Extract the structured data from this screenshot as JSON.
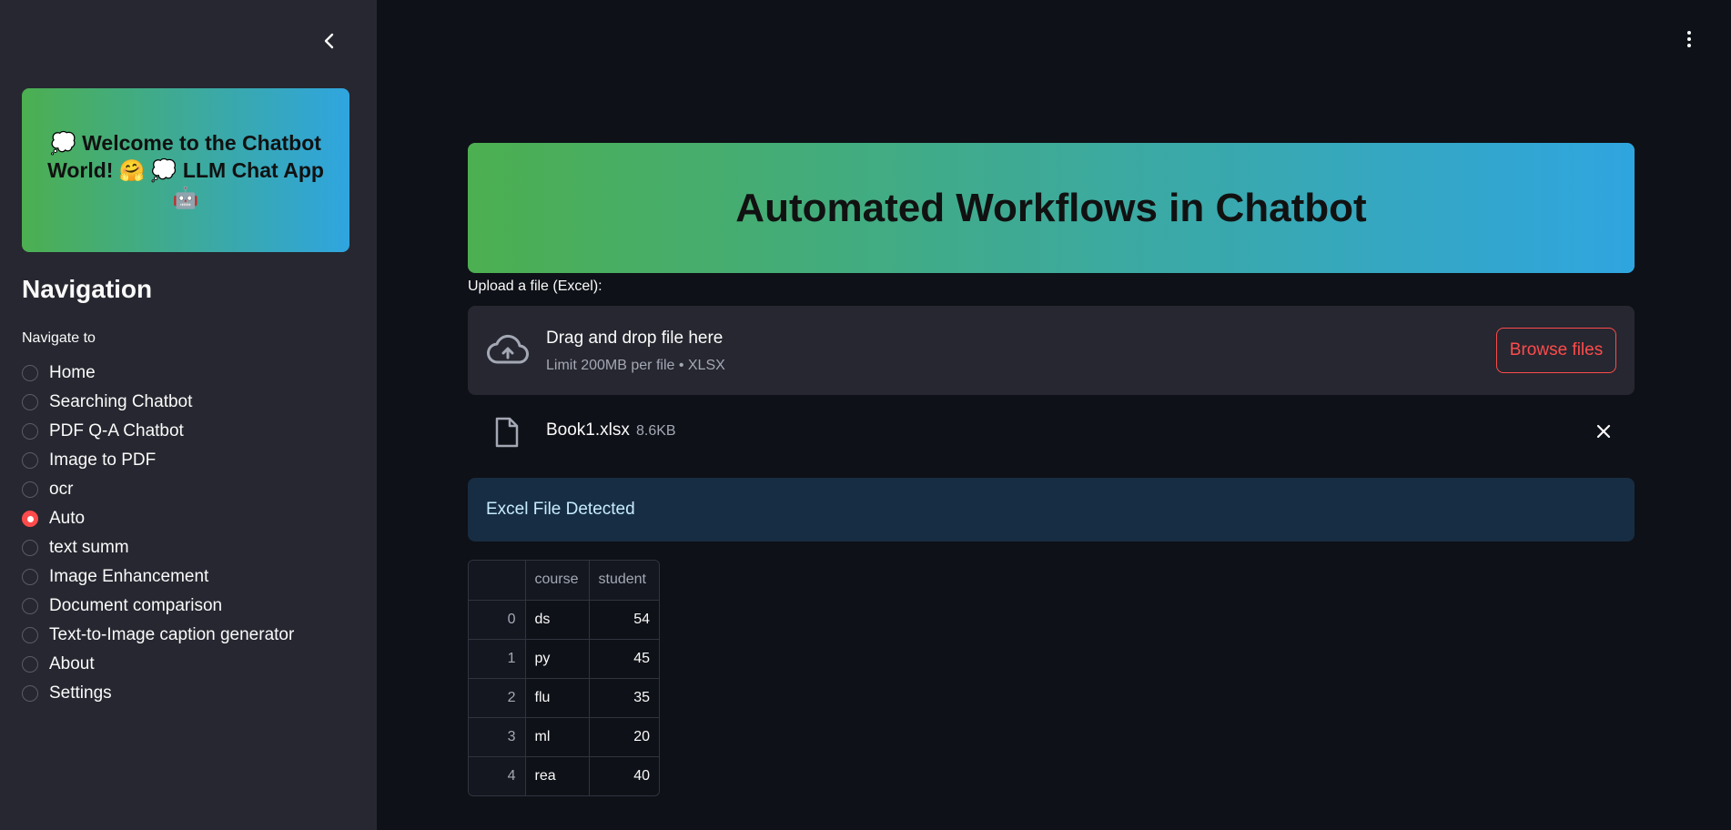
{
  "sidebar": {
    "welcome_text": "💭 Welcome to the Chatbot World! 🤗 💭 LLM Chat App 🤖",
    "nav_heading": "Navigation",
    "nav_label": "Navigate to",
    "items": [
      {
        "label": "Home",
        "selected": false
      },
      {
        "label": "Searching Chatbot",
        "selected": false
      },
      {
        "label": "PDF Q-A Chatbot",
        "selected": false
      },
      {
        "label": "Image to PDF",
        "selected": false
      },
      {
        "label": "ocr",
        "selected": false
      },
      {
        "label": "Auto",
        "selected": true
      },
      {
        "label": "text summ",
        "selected": false
      },
      {
        "label": "Image Enhancement",
        "selected": false
      },
      {
        "label": "Document comparison",
        "selected": false
      },
      {
        "label": "Text-to-Image caption generator",
        "selected": false
      },
      {
        "label": "About",
        "selected": false
      },
      {
        "label": "Settings",
        "selected": false
      }
    ]
  },
  "main": {
    "banner_title": "Automated Workflows in Chatbot",
    "upload_label": "Upload a file (Excel):",
    "dropzone": {
      "title": "Drag and drop file here",
      "subtitle": "Limit 200MB per file • XLSX",
      "browse_label": "Browse files"
    },
    "file": {
      "name": "Book1.xlsx",
      "size": "8.6KB"
    },
    "alert_text": "Excel File Detected",
    "table": {
      "columns": [
        "",
        "course",
        "student"
      ],
      "rows": [
        [
          "0",
          "ds",
          "54"
        ],
        [
          "1",
          "py",
          "45"
        ],
        [
          "2",
          "flu",
          "35"
        ],
        [
          "3",
          "ml",
          "20"
        ],
        [
          "4",
          "rea",
          "40"
        ]
      ]
    }
  },
  "colors": {
    "accent": "#ff4b4b",
    "background": "#0e1117",
    "sidebar": "#262730",
    "gradient_start": "#4caf50",
    "gradient_end": "#2fa5e0",
    "alert_bg": "#172d43"
  }
}
